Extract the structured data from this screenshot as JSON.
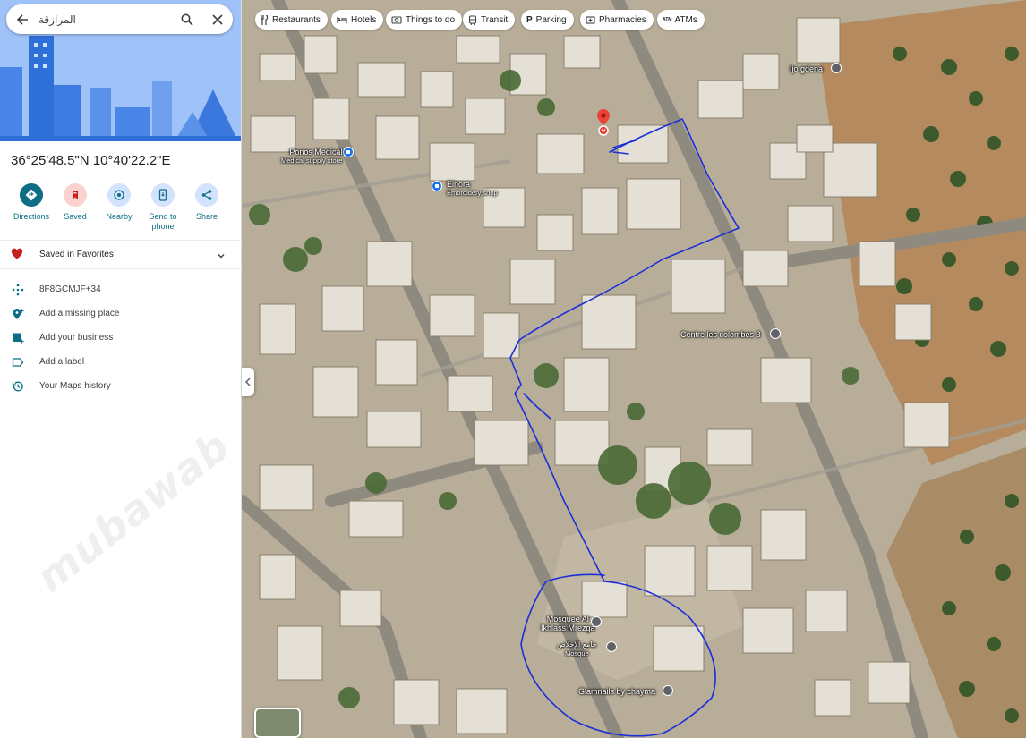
{
  "search": {
    "value": "المرازقة"
  },
  "coordinates": "36°25'48.5\"N 10°40'22.2\"E",
  "actions": [
    {
      "label": "Directions"
    },
    {
      "label": "Saved"
    },
    {
      "label": "Nearby"
    },
    {
      "label": "Send to\nphone"
    },
    {
      "label": "Share"
    }
  ],
  "saved_status": "Saved in Favorites",
  "details": [
    {
      "icon": "plus-code-icon",
      "text": "8F8GCMJF+34"
    },
    {
      "icon": "add-place-icon",
      "text": "Add a missing place"
    },
    {
      "icon": "add-business-icon",
      "text": "Add your business"
    },
    {
      "icon": "label-icon",
      "text": "Add a label"
    },
    {
      "icon": "history-icon",
      "text": "Your Maps history"
    }
  ],
  "chips": [
    {
      "icon": "restaurant-icon",
      "label": "Restaurants"
    },
    {
      "icon": "hotel-icon",
      "label": "Hotels"
    },
    {
      "icon": "camera-icon",
      "label": "Things to do"
    },
    {
      "icon": "transit-icon",
      "label": "Transit"
    },
    {
      "icon": "parking-icon",
      "label": "Parking"
    },
    {
      "icon": "pharmacy-icon",
      "label": "Pharmacies"
    },
    {
      "icon": "atm-icon",
      "label": "ATMs"
    }
  ],
  "places": {
    "ponos": {
      "name": "Ponos Medical",
      "category": "Medical supply store"
    },
    "elhora": {
      "name": "Elhora",
      "category": "Embroidery shop"
    },
    "ijo": {
      "name": "Ijo gdena"
    },
    "centre": {
      "name": "Centre les colombes 3"
    },
    "mosque1": {
      "name_line1": "Mosquee Al",
      "name_line2": "Ikhlass Mrezga"
    },
    "mosque2": {
      "name": "جامع الإخلاص",
      "category": "Mosque"
    },
    "glam": {
      "name": "Glamnails by chayma"
    }
  },
  "watermark": "mubawab",
  "colors": {
    "accent": "#0b6e85",
    "pin": "#ea4335",
    "drawn_path": "#1a2fd8",
    "saved_heart": "#c5221f"
  }
}
